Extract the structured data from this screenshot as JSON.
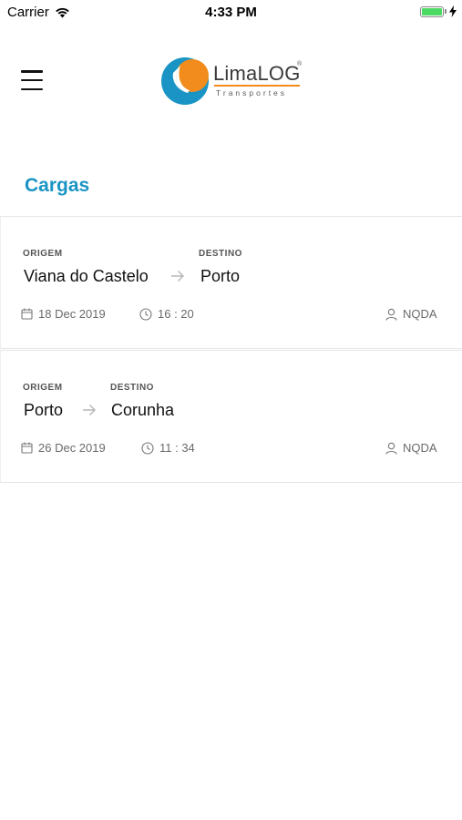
{
  "status_bar": {
    "carrier": "Carrier",
    "time": "4:33 PM"
  },
  "header": {
    "logo_name": "LimaLOG",
    "logo_reg": "®",
    "logo_sub": "Transportes"
  },
  "page": {
    "title": "Cargas"
  },
  "cargas": [
    {
      "origem_label": "ORIGEM",
      "destino_label": "DESTINO",
      "origem": "Viana do Castelo",
      "destino": "Porto",
      "date": "18 Dec 2019",
      "time": "16 : 20",
      "user": "NQDA"
    },
    {
      "origem_label": "ORIGEM",
      "destino_label": "DESTINO",
      "origem": "Porto",
      "destino": "Corunha",
      "date": "26 Dec 2019",
      "time": "11 : 34",
      "user": "NQDA"
    }
  ],
  "colors": {
    "accent": "#1a94c4",
    "logo_blue": "#1a94c4",
    "logo_orange": "#f28c1c",
    "battery": "#4cd964"
  }
}
